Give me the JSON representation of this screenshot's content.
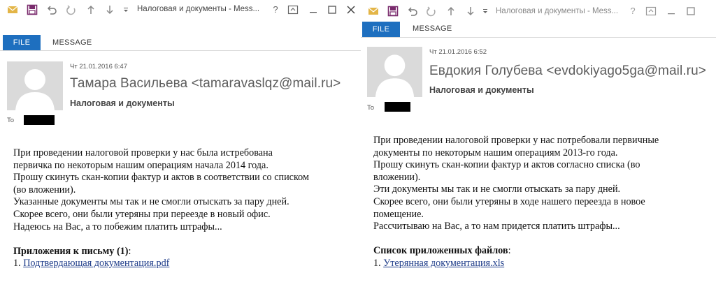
{
  "left": {
    "window_title": "Налоговая и документы - Mess...",
    "tabs": {
      "file": "FILE",
      "message": "MESSAGE"
    },
    "header": {
      "date": "Чт 21.01.2016 6:47",
      "from": "Тамара Васильева <tamaravaslqz@mail.ru>",
      "subject": "Налоговая и документы",
      "to_label": "To"
    },
    "body": [
      "При проведении налоговой проверки у нас была истребована",
      "первичка по некоторым нашим операциям начала 2014 года.",
      "Прошу скинуть скан-копии фактур и актов в соответствии со списком",
      "(во вложении).",
      "Указанные документы мы так и не смогли отыскать за пару дней.",
      "Скорее всего, они были утеряны при переезде в новый офис.",
      "Надеюсь на Вас, а то побежим платить штрафы..."
    ],
    "attachments_heading": "Приложения к письму (1)",
    "attachments_colon": ":",
    "attachment_number": "1.",
    "attachment_name": "Подтвердающая документация.pdf"
  },
  "right": {
    "window_title": "Налоговая и документы - Mess...",
    "tabs": {
      "file": "FILE",
      "message": "MESSAGE"
    },
    "header": {
      "date": "Чт 21.01.2016 6:52",
      "from": "Евдокия Голубева <evdokiyago5ga@mail.ru>",
      "subject": "Налоговая и документы",
      "to_label": "To"
    },
    "body": [
      "При проведении налоговой проверки у нас потребовали первичные",
      "документы по некоторым нашим операциям 2013-го года.",
      "Прошу скинуть скан-копии фактур и актов согласно списка (во",
      "вложении).",
      "Эти документы мы так и не смогли отыскать за пару дней.",
      "Скорее всего, они были утеряны в ходе нашего переезда в новое",
      "помещение.",
      "Рассчитываю на Вас, а то нам придется платить штрафы..."
    ],
    "attachments_heading": "Список приложенных файлов",
    "attachments_colon": ":",
    "attachment_number": "1.",
    "attachment_name": "Утерянная документация.xls"
  },
  "colors": {
    "file_tab": "#1e6fbf",
    "link": "#1f3d8a",
    "envelope": "#e3b547",
    "save": "#7a2b6d"
  },
  "icons": [
    "envelope-icon",
    "save-icon",
    "undo-icon",
    "redo-icon",
    "up-arrow-icon",
    "down-arrow-icon",
    "customize-toolbar-icon",
    "help-icon",
    "ribbon-display-icon",
    "minimize-icon",
    "maximize-icon",
    "close-icon",
    "avatar-placeholder-icon"
  ]
}
